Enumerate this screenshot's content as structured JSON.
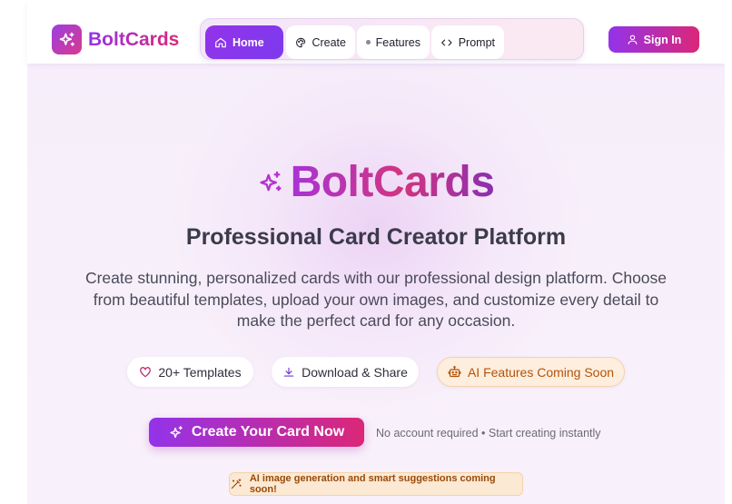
{
  "brand": {
    "name": "BoltCards"
  },
  "nav": {
    "items": [
      {
        "label": "Home",
        "icon": "home-icon",
        "active": true
      },
      {
        "label": "Create",
        "icon": "palette-icon"
      },
      {
        "label": "Features",
        "icon": "dot-icon"
      },
      {
        "label": "Prompt",
        "icon": "code-icon"
      }
    ]
  },
  "header": {
    "signin_label": "Sign In"
  },
  "hero": {
    "title": "BoltCards",
    "subtitle": "Professional Card Creator Platform",
    "description": "Create stunning, personalized cards with our professional design platform. Choose from beautiful templates, upload your own images, and customize every detail to make the perfect card for any occasion."
  },
  "features": [
    {
      "label": "20+ Templates",
      "icon": "heart-icon"
    },
    {
      "label": "Download & Share",
      "icon": "download-icon"
    },
    {
      "label": "AI Features Coming Soon",
      "icon": "robot-icon"
    }
  ],
  "cta": {
    "label": "Create Your Card Now",
    "note": "No account required • Start creating instantly"
  },
  "banner": {
    "text": "AI image generation and smart suggestions coming soon!"
  },
  "colors": {
    "primary": "#9333ea",
    "accent": "#db2777",
    "ai": "#b4530a"
  }
}
